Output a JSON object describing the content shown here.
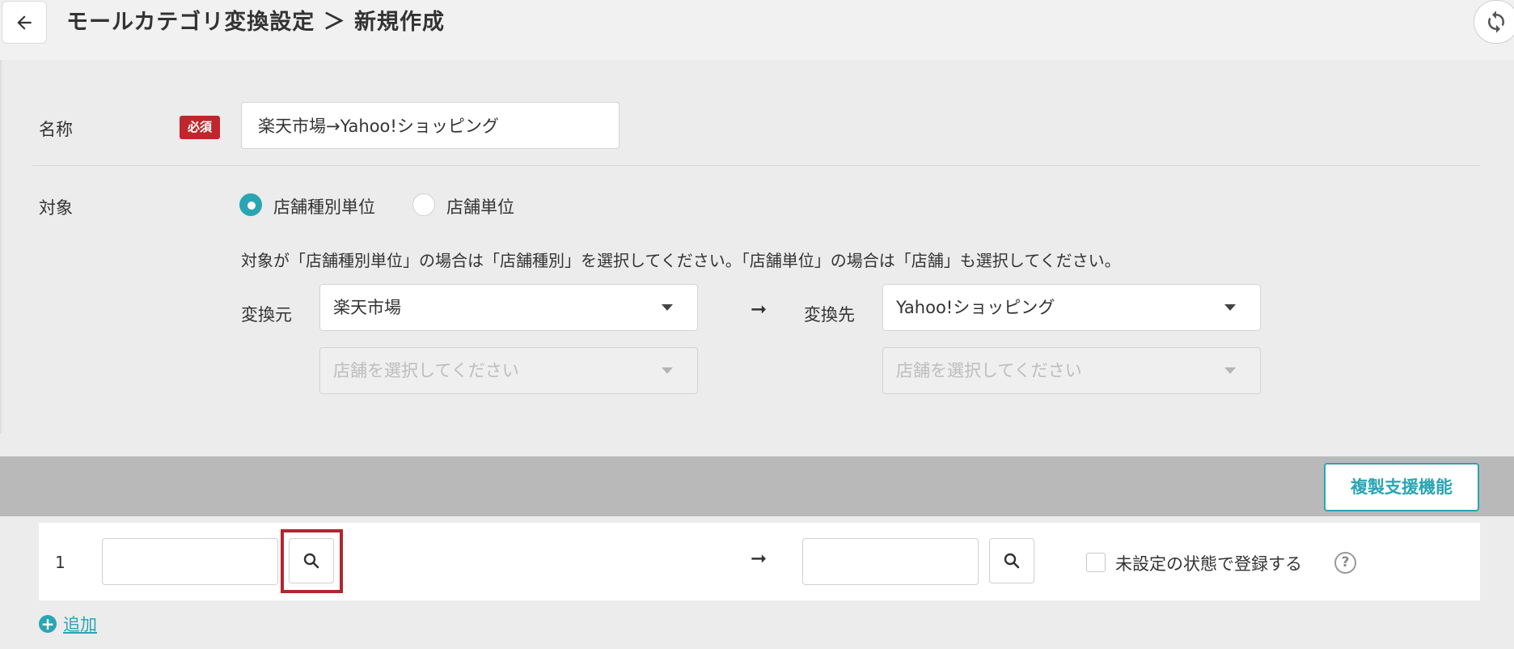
{
  "header": {
    "title": "モールカテゴリ変換設定 ＞ 新規作成",
    "back_icon": "arrow-left-icon",
    "refresh_icon": "refresh-icon"
  },
  "form": {
    "name_label": "名称",
    "required_badge": "必須",
    "name_value": "楽天市場→Yahoo!ショッピング",
    "target_label": "対象",
    "radio_options": [
      {
        "label": "店舗種別単位",
        "checked": true
      },
      {
        "label": "店舗単位",
        "checked": false
      }
    ],
    "note": "対象が「店舗種別単位」の場合は「店舗種別」を選択してください。「店舗単位」の場合は「店舗」も選択してください。",
    "source_label": "変換元",
    "source_value": "楽天市場",
    "source_store_placeholder": "店舗を選択してください",
    "arrow": "➞",
    "dest_label": "変換先",
    "dest_value": "Yahoo!ショッピング",
    "dest_store_placeholder": "店舗を選択してください"
  },
  "mapping": {
    "duplicate_button": "複製支援機能",
    "rows": [
      {
        "number": "1",
        "arrow": "➞",
        "unset_label": "未設定の状態で登録する",
        "help": "?"
      }
    ],
    "add_label": "追加",
    "add_icon": "+"
  },
  "colors": {
    "accent": "#2aa5b3",
    "required": "#c0262d",
    "highlight": "#b3262e"
  }
}
